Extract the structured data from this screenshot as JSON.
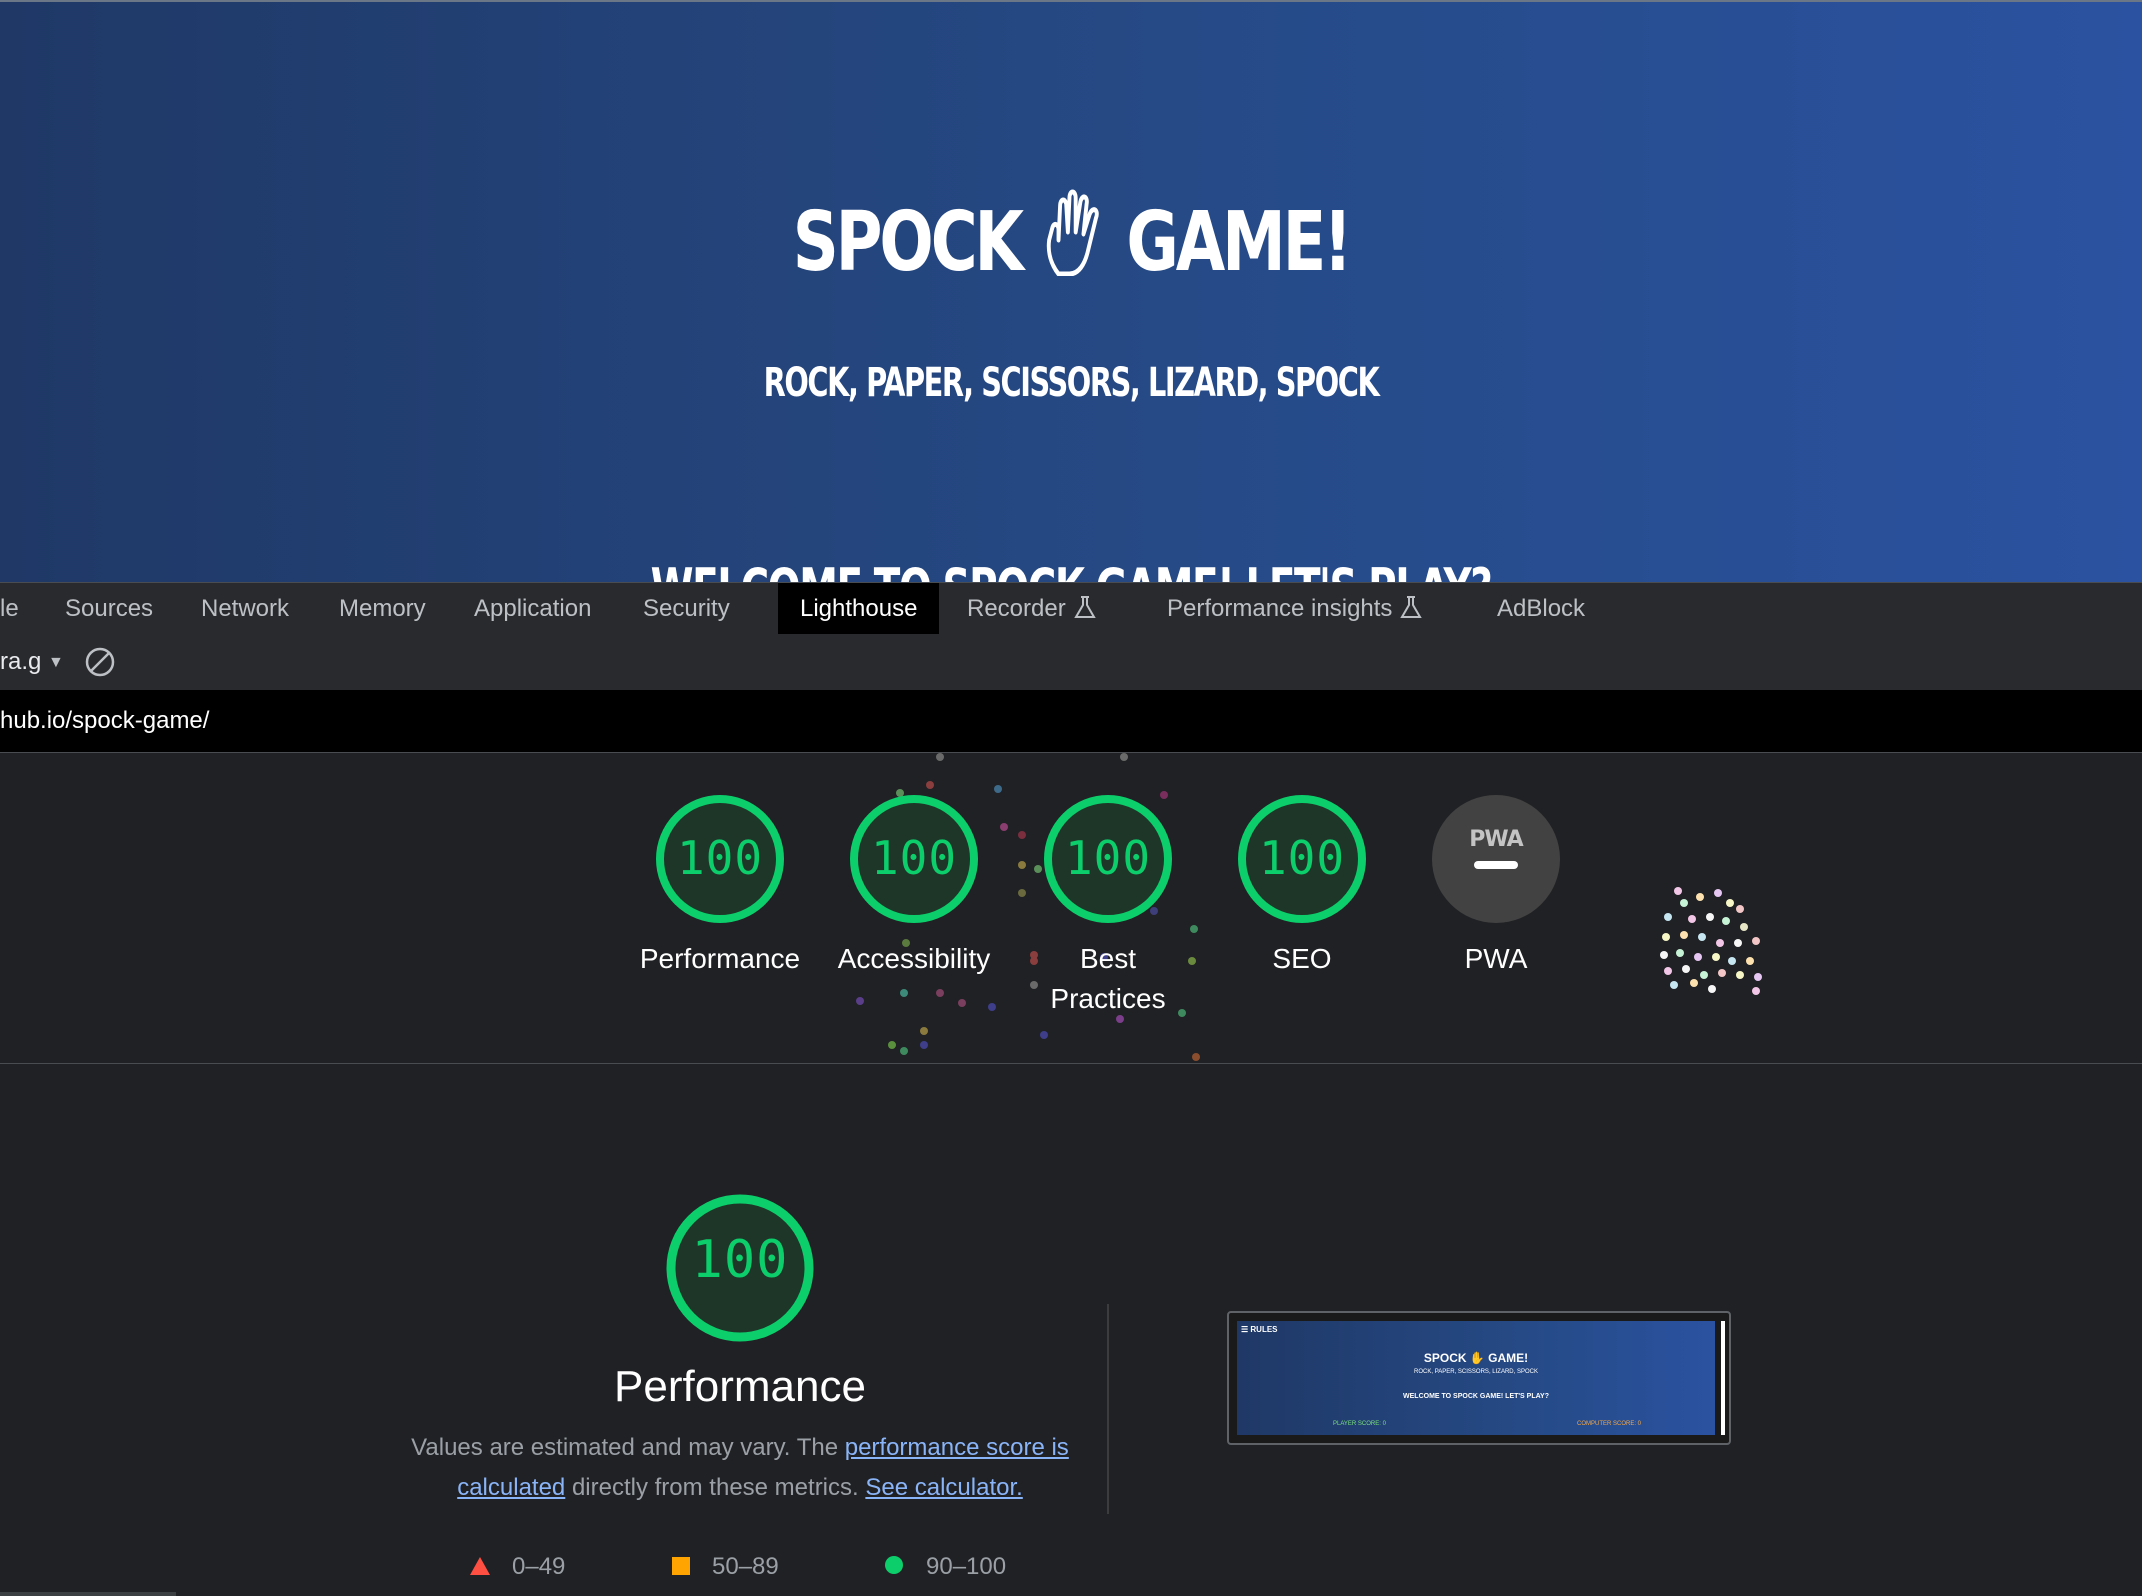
{
  "page_preview": {
    "title_left": "SPOCK",
    "title_right": "GAME!",
    "subtitle": "ROCK, PAPER, SCISSORS, LIZARD, SPOCK",
    "welcome": "WELCOME TO SPOCK GAME! LET'S PLAY?"
  },
  "devtools": {
    "tabs": [
      "le",
      "Sources",
      "Network",
      "Memory",
      "Application",
      "Security",
      "Lighthouse",
      "Recorder",
      "Performance insights",
      "AdBlock"
    ],
    "active_tab": "Lighthouse"
  },
  "toolbar": {
    "report_selector": "ra.g",
    "url": "hub.io/spock-game/"
  },
  "scores": [
    {
      "label": "Performance",
      "score": "100"
    },
    {
      "label": "Accessibility",
      "score": "100"
    },
    {
      "label": "Best Practices",
      "label_line1": "Best",
      "label_line2": "Practices",
      "score": "100"
    },
    {
      "label": "SEO",
      "score": "100"
    },
    {
      "label": "PWA",
      "badge": "PWA"
    }
  ],
  "performance": {
    "score": "100",
    "title": "Performance",
    "desc_prefix": "Values are estimated and may vary. The ",
    "link1": "performance score is calculated",
    "desc_middle": " directly from these metrics. ",
    "link2": "See calculator."
  },
  "legend": [
    {
      "range": "0–49",
      "color": "#ff4e42",
      "shape": "triangle"
    },
    {
      "range": "50–89",
      "color": "#ffa400",
      "shape": "square"
    },
    {
      "range": "90–100",
      "color": "#0cce6b",
      "shape": "circle"
    }
  ],
  "thumbnail": {
    "menu_label": "☰ RULES",
    "title": "SPOCK ✋ GAME!",
    "subtitle": "ROCK, PAPER, SCISSORS, LIZARD, SPOCK",
    "welcome": "WELCOME TO SPOCK GAME! LET'S PLAY?",
    "player_score": "PLAYER SCORE: 0",
    "computer_score": "COMPUTER SCORE: 0"
  },
  "colors": {
    "pass": "#0cce6b",
    "pass_bg": "#1e3628",
    "devtools_bg": "#202124",
    "link": "#8ab4f8"
  },
  "icons": {
    "hand": "vulcan-hand-icon",
    "block": "block-icon",
    "flask": "experiment-flask-icon"
  }
}
